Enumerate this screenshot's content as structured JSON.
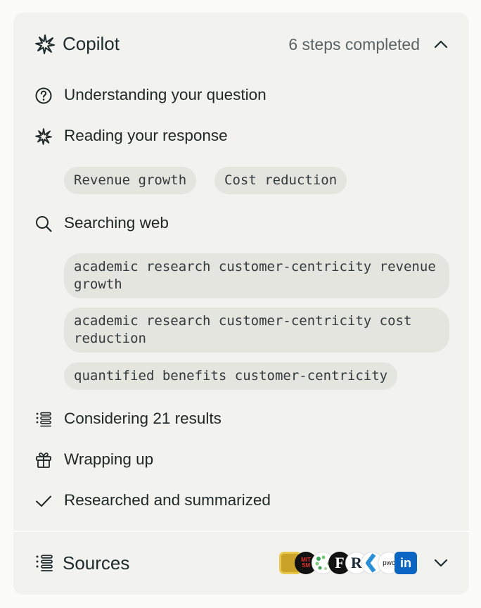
{
  "header": {
    "title": "Copilot",
    "status": "6 steps completed",
    "logo_icon": "sparkle-icon",
    "toggle_icon": "chevron-up-icon"
  },
  "steps": [
    {
      "label": "Understanding your question",
      "icon": "question-circle-icon"
    },
    {
      "label": "Reading your response",
      "icon": "sparkle-icon",
      "chips": [
        "Revenue growth",
        "Cost reduction"
      ]
    },
    {
      "label": "Searching web",
      "icon": "search-icon",
      "queries": [
        "academic research customer-centricity revenue growth",
        "academic research customer-centricity cost reduction",
        "quantified benefits customer-centricity"
      ]
    },
    {
      "label": "Considering 21 results",
      "icon": "list-icon"
    },
    {
      "label": "Wrapping up",
      "icon": "gift-icon"
    },
    {
      "label": "Researched and summarized",
      "icon": "check-icon"
    }
  ],
  "sources": {
    "title": "Sources",
    "icon": "list-icon",
    "toggle_icon": "chevron-down-icon",
    "favicons": [
      {
        "name": "gold-logo-icon",
        "text": ""
      },
      {
        "name": "mit-sloan-logo-icon",
        "text": "MIT SM"
      },
      {
        "name": "dots-logo-icon",
        "text": ""
      },
      {
        "name": "f-logo-icon",
        "text": "F"
      },
      {
        "name": "r-logo-icon",
        "text": "R"
      },
      {
        "name": "k-logo-icon",
        "text": ""
      },
      {
        "name": "pwc-logo-icon",
        "text": "pwc"
      },
      {
        "name": "linkedin-logo-icon",
        "text": "in"
      }
    ]
  },
  "colors": {
    "panel_bg": "#f2f2ee",
    "chip_bg": "#e5e5e0",
    "text": "#1f2626",
    "muted": "#5a6263"
  }
}
